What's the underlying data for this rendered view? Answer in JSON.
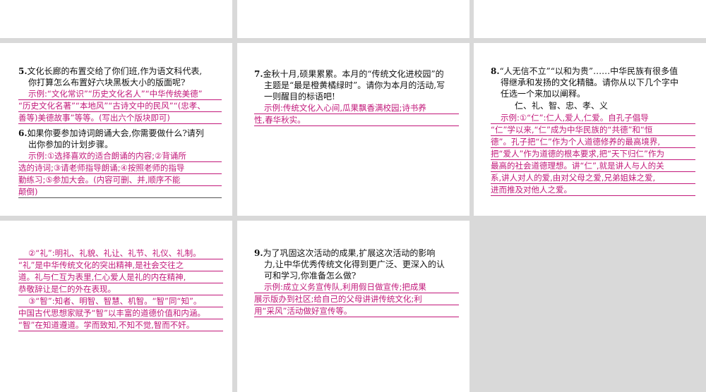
{
  "q5": {
    "num": "5.",
    "text_l1": "文化长廊的布置交给了你们班,作为语文科代表,",
    "text_l2": "你打算怎么布置好六块黑板大小的版面呢?",
    "answer_lines": [
      "示例:“文化常识”“历史文化名人”“中华传统美德”",
      "“历史文化名著”“本地风”“古诗文中的民风”“(忠孝、",
      "善等)美德故事”等等。(写出六个版块即可)"
    ]
  },
  "q6": {
    "num": "6.",
    "text_l1": "如果你要参加诗词朗诵大会,你需要做什么?请列",
    "text_l2": "出你参加的计划步骤。",
    "answer_lines": [
      "示例:①选择喜欢的适合朗诵的内容;②背诵所",
      "选的诗词;③请老师指导朗诵;④按照老师的指导",
      "勤练习;⑤参加大会。(内容可删、并,顺序不能",
      "颠倒)"
    ]
  },
  "q7": {
    "num": "7.",
    "text_l1": "金秋十月,硕果累累。本月的“传统文化进校园”的",
    "text_l2": "主题是“最是橙黄橘绿时”。请你为本月的活动,写",
    "text_l3": "一则醒目的标语吧!",
    "answer_lines": [
      "示例:传统文化入心间,瓜果飘香满校园;诗书养",
      "性,春华秋实。"
    ]
  },
  "q8": {
    "num": "8.",
    "text_l1": "“人无信不立”“以和为贵”……中华民族有很多值",
    "text_l2": "得继承和发扬的文化精髓。请你从以下几个字中",
    "text_l3": "任选一个来加以阐释。",
    "chars": "仁、礼、智、忠、孝、义",
    "answer_lines": [
      "示例:①“仁”:仁人,爱人,仁爱。自孔子倡导",
      "“仁”学以来,“仁”成为中华民族的“共德”和“恒",
      "德”。孔子把“仁”作为个人道德修养的最高境界,",
      "把“爱人”作为道德的根本要求,把“天下归仁”作为",
      "最高的社会道德理想。讲“仁”,就是讲人与人的关",
      "系,讲人对人的爱,由对父母之爱,兄弟姐妹之爱,",
      "进而推及对他人之爱。"
    ]
  },
  "cont": {
    "answer_lines": [
      "②“礼”:明礼、礼貌、礼让、礼节、礼仪、礼制。",
      "“礼”是中华传统文化的突出精神,是社会交往之",
      "道。礼与仁互为表里,仁心爱人是礼的内在精神,",
      "恭敬辞让是仁的外在表现。",
      "③“智”:知者、明智、智慧、机智。“智”同“知”。",
      "中国古代思想家赋予“智”以丰富的道德价值和内涵。",
      "“智”在知道遵道。学而致知,不知不觉,智而不奸。"
    ]
  },
  "q9": {
    "num": "9.",
    "text_l1": "为了巩固这次活动的成果,扩展这次活动的影响",
    "text_l2": "力,让中华优秀传统文化得到更广泛、更深入的认",
    "text_l3": "可和学习,你准备怎么做?",
    "answer_lines": [
      "示例:成立义务宣传队,利用假日做宣传;把成果",
      "展示版办到社区;给自己的父母讲讲传统文化;利",
      "用“采风”活动做好宣传等。"
    ]
  }
}
